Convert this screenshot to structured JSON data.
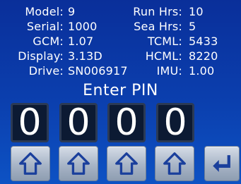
{
  "info": {
    "left": [
      {
        "label": "Model:",
        "value": "9"
      },
      {
        "label": "Serial:",
        "value": "1000"
      },
      {
        "label": "GCM:",
        "value": "1.07"
      },
      {
        "label": "Display:",
        "value": "3.13D"
      },
      {
        "label": "Drive:",
        "value": "SN006917"
      }
    ],
    "right": [
      {
        "label": "Run Hrs:",
        "value": "10"
      },
      {
        "label": "Sea Hrs:",
        "value": "5"
      },
      {
        "label": "TCML:",
        "value": "5433"
      },
      {
        "label": "HCML:",
        "value": "8220"
      },
      {
        "label": "IMU:",
        "value": "1.00"
      }
    ]
  },
  "pin": {
    "title": "Enter PIN",
    "digits": [
      "0",
      "0",
      "0",
      "0"
    ]
  },
  "buttons": {
    "increment_icon": "arrow-up-icon",
    "enter_icon": "enter-return-icon"
  },
  "colors": {
    "background_top": "#0a2f9a",
    "background_bottom": "#0d52c4",
    "digit_box": "#0c1a33",
    "button": "#b3bfcf",
    "icon": "#1a3f9c"
  }
}
